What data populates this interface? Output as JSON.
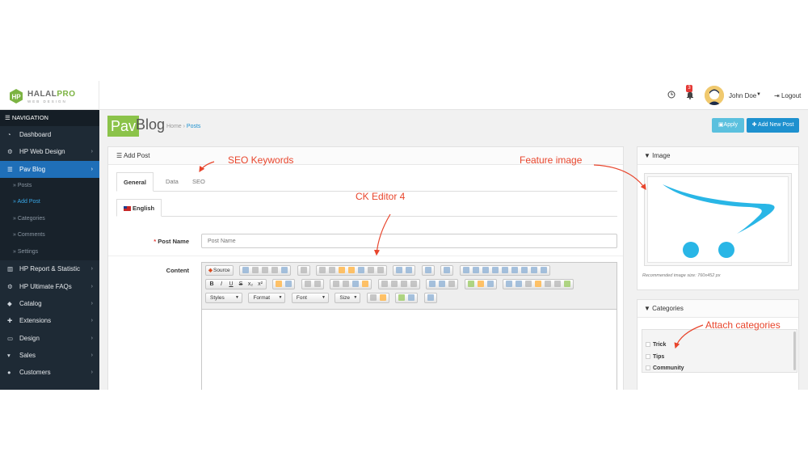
{
  "brand": {
    "logo_main": "HALAL",
    "logo_accent": "PRO",
    "logo_sub": "WEB DESIGN"
  },
  "topbar": {
    "notification_count": "3",
    "user_name": "John Doe",
    "logout_label": "Logout"
  },
  "sidebar": {
    "header": "NAVIGATION",
    "items_top": [
      {
        "label": "Dashboard",
        "icon": "dashboard-icon"
      },
      {
        "label": "HP Web Design",
        "icon": "cogs-icon"
      },
      {
        "label": "Pav Blog",
        "icon": "list-icon",
        "active": true
      }
    ],
    "sub_items": [
      {
        "label": "Posts"
      },
      {
        "label": "Add Post",
        "current": true
      },
      {
        "label": "Categories"
      },
      {
        "label": "Comments"
      },
      {
        "label": "Settings"
      }
    ],
    "items_bottom": [
      {
        "label": "HP Report & Statistic",
        "icon": "bar-chart-icon"
      },
      {
        "label": "HP Ultimate FAQs",
        "icon": "cogs-icon"
      },
      {
        "label": "Catalog",
        "icon": "tag-icon"
      },
      {
        "label": "Extensions",
        "icon": "puzzle-icon"
      },
      {
        "label": "Design",
        "icon": "monitor-icon"
      },
      {
        "label": "Sales",
        "icon": "cart-icon"
      },
      {
        "label": "Customers",
        "icon": "user-icon"
      }
    ]
  },
  "header": {
    "pav_logo": "Pav",
    "title": "Blog",
    "breadcrumb_home": "Home",
    "breadcrumb_current": "Posts",
    "apply_label": "Apply",
    "add_label": "Add New Post"
  },
  "main": {
    "panel_title": "Add Post",
    "tabs": [
      {
        "label": "General",
        "active": true
      },
      {
        "label": "Data"
      },
      {
        "label": "SEO"
      }
    ],
    "language_tab": "English",
    "post_name_label": "Post Name",
    "post_name_placeholder": "Post Name",
    "content_label": "Content",
    "editor": {
      "source_label": "Source",
      "combos": [
        "Styles",
        "Format",
        "Font",
        "Size"
      ]
    }
  },
  "image_panel": {
    "title": "Image",
    "note": "Recommended image size: 760x452 px",
    "logo_color": "#29b6e6"
  },
  "categories_panel": {
    "title": "Categories",
    "items": [
      "Trick",
      "Tips",
      "Community"
    ]
  },
  "annotations": {
    "seo": "SEO Keywords",
    "feature": "Feature image",
    "ck": "CK Editor 4",
    "attach": "Attach categories",
    "color": "#e8452c"
  },
  "colors": {
    "sidebar_bg": "#1e2a35",
    "accent_blue": "#1e91cf",
    "apply_blue": "#5bc0de",
    "pav_green": "#8bc34a"
  }
}
